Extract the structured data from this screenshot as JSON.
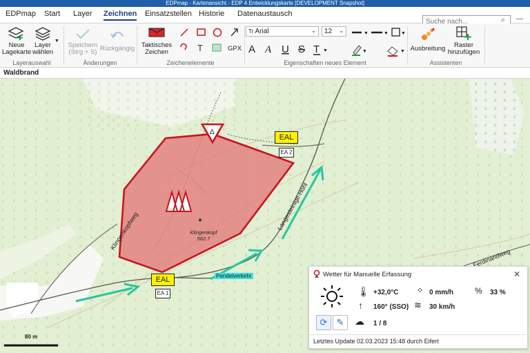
{
  "window": {
    "title": "EDPmap - Kartenansicht - EDP 4 Entwicklungskarte [DEVELOPMENT Snapshot]",
    "controls": [
      "—",
      "☐",
      "✕"
    ]
  },
  "tabs": {
    "app": "EDPmap",
    "items": [
      "Start",
      "Layer",
      "Zeichnen",
      "Einsatzstellen",
      "Historie",
      "Datenaustausch"
    ],
    "active": "Zeichnen"
  },
  "search": {
    "placeholder": "Suche nach..."
  },
  "ribbon": {
    "new_map": "Neue\nLagekarte",
    "select_layer": "Layer\nwählen",
    "group_layer": "Layerauswahl",
    "save": "Speichern\n(Strg + S)",
    "undo": "Rückgängig",
    "group_changes": "Änderungen",
    "tactical": "Taktisches\nZeichen",
    "gpx": "GPX",
    "group_elements": "Zeichenelemente",
    "font": "Arial",
    "font_size": "12",
    "group_props": "Eigenschaften neues Element",
    "spread": "Ausbreitung",
    "grid": "Raster\nhinzufügen",
    "group_assist": "Assistenten"
  },
  "breadcrumb": {
    "title": "Waldbrand"
  },
  "map": {
    "labels": {
      "eal1": "EAL",
      "ea1": "EA 1",
      "eal2": "EAL",
      "ea2": "EA 2",
      "peak": "Klingenkopf",
      "peak_height": "562.7",
      "road1": "Klingenkopfweg",
      "road2": "Langesteinige-Höhl",
      "road3": "Ferdinandweg",
      "shuttle": "Pendelverkehr",
      "scale": "80 m"
    },
    "colors": {
      "area_fill": "#e27a7a",
      "area_stroke": "#c8141e",
      "arrow": "#24c7a0",
      "eal": "#fff200"
    }
  },
  "weather": {
    "title": "Wetter für Manuelle Erfassung",
    "temperature": "+32,0°C",
    "precip": "0 mm/h",
    "humidity": "33 %",
    "wind_dir": "160° (SSO)",
    "wind_speed": "30 km/h",
    "cloud": "1 / 8",
    "footer": "Letztes Update 02.03.2023 15:48 durch Eifert"
  }
}
